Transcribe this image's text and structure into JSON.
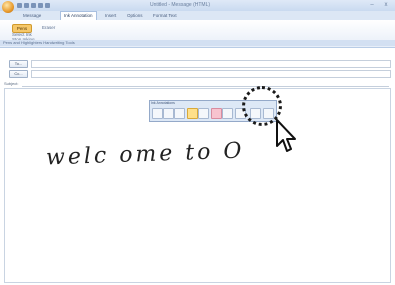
{
  "window": {
    "title": "Untitled - Message (HTML)",
    "min": "–",
    "close": "x"
  },
  "ribbon": {
    "tabs": [
      {
        "label": "Message",
        "active": false
      },
      {
        "label": "Ink Annotation",
        "active": true
      },
      {
        "label": "Insert",
        "active": false
      },
      {
        "label": "Options",
        "active": false
      },
      {
        "label": "Format Text",
        "active": false
      }
    ],
    "ink_pen_label": "Pens",
    "eraser_label": "Eraser",
    "select_label": "Select Ink",
    "more_label": "Stop Inking",
    "groups_label": "Pens and Highlighters   Handwriting Tools"
  },
  "header": {
    "to_button": "To...",
    "cc_button": "Cc...",
    "subject_label": "Subject:"
  },
  "ink_toolbar": {
    "title": "Ink Annotations"
  },
  "body": {
    "ink_text": "welc ome to O"
  }
}
